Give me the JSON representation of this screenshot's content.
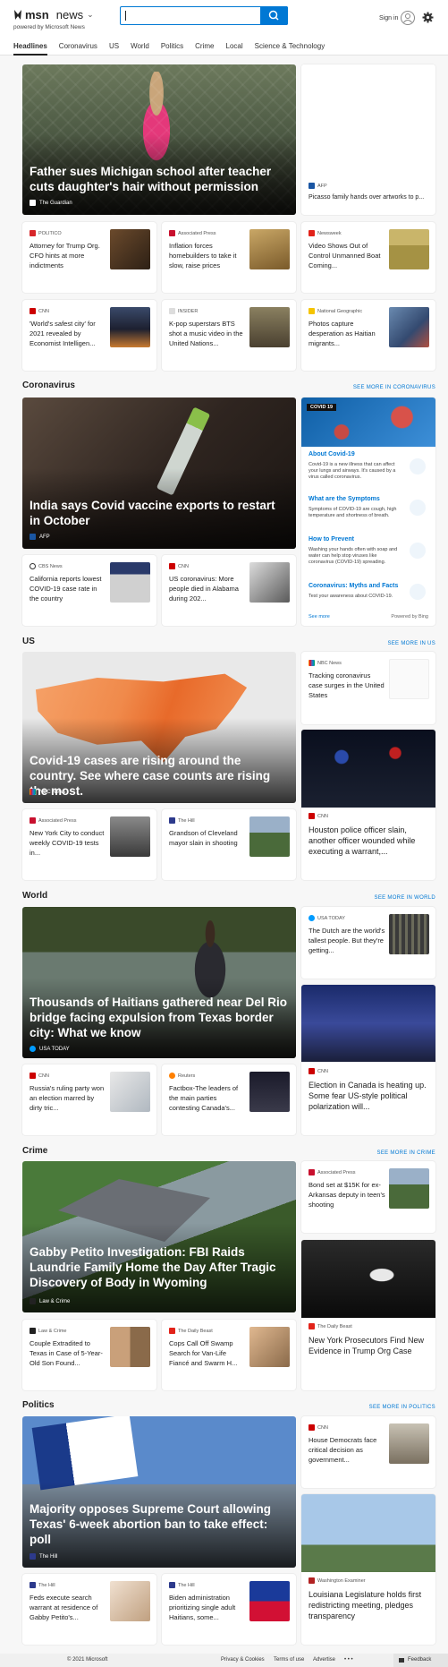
{
  "header": {
    "msn": "msn",
    "news": "news",
    "caret": "⌄",
    "powered": "powered by Microsoft News",
    "signin": "Sign in"
  },
  "nav": [
    "Headlines",
    "Coronavirus",
    "US",
    "World",
    "Politics",
    "Crime",
    "Local",
    "Science & Technology"
  ],
  "top": {
    "hero": {
      "title": "Father sues Michigan school after teacher cuts daughter's hair without permission",
      "source": "The Guardian"
    },
    "right": {
      "source": "AFP",
      "title": "Picasso family hands over artworks to p..."
    },
    "cards": [
      {
        "source": "POLITICO",
        "title": "Attorney for Trump Org. CFO hints at more indictments"
      },
      {
        "source": "Associated Press",
        "title": "Inflation forces homebuilders to take it slow, raise prices"
      },
      {
        "source": "Newsweek",
        "title": "Video Shows Out of Control Unmanned Boat Coming..."
      },
      {
        "source": "CNN",
        "title": "'World's safest city' for 2021 revealed by Economist Intelligen..."
      },
      {
        "source": "INSIDER",
        "title": "K-pop superstars BTS shot a music video in the United Nations..."
      },
      {
        "source": "National Geographic",
        "title": "Photos capture desperation as Haitian migrants..."
      }
    ]
  },
  "coronavirus": {
    "title": "Coronavirus",
    "see_more": "SEE MORE IN CORONAVIRUS",
    "hero": {
      "title": "India says Covid vaccine exports to restart in October",
      "source": "AFP"
    },
    "cards": [
      {
        "source": "CBS News",
        "title": "California reports lowest COVID-19 case rate in the country"
      },
      {
        "source": "CNN",
        "title": "US coronavirus: More people died in Alabama during 202..."
      }
    ],
    "panel": {
      "badge": "COVID 19",
      "items": [
        {
          "t": "About Covid-19",
          "d": "Covid-19 is a new illness that can affect your lungs and airways. It's caused by a virus called coronavirus."
        },
        {
          "t": "What are the Symptoms",
          "d": "Symptoms of COVID-19 are cough, high temperature and shortness of breath."
        },
        {
          "t": "How to Prevent",
          "d": "Washing your hands often with soap and water can help stop viruses like coronavirus (COVID-19) spreading."
        },
        {
          "t": "Coronavirus: Myths and Facts",
          "d": "Test your awareness about COVID-19."
        }
      ],
      "see_more": "See more",
      "powered": "Powered by Bing"
    }
  },
  "us": {
    "title": "US",
    "see_more": "SEE MORE IN US",
    "hero": {
      "title": "Covid-19 cases are rising around the country. See where case counts are rising the most.",
      "source": "NBC News"
    },
    "right": {
      "source": "NBC News",
      "title": "Tracking coronavirus case surges in the United States"
    },
    "cards": [
      {
        "source": "Associated Press",
        "title": "New York City to conduct weekly COVID-19 tests in..."
      },
      {
        "source": "The Hill",
        "title": "Grandson of Cleveland mayor slain in shooting"
      }
    ],
    "right2": {
      "source": "CNN",
      "title": "Houston police officer slain, another officer wounded while executing a warrant,..."
    }
  },
  "world": {
    "title": "World",
    "see_more": "SEE MORE IN WORLD",
    "hero": {
      "title": "Thousands of Haitians gathered near Del Rio bridge facing expulsion from Texas border city: What we know",
      "source": "USA TODAY"
    },
    "right": {
      "source": "USA TODAY",
      "title": "The Dutch are the world's tallest people. But they're getting..."
    },
    "cards": [
      {
        "source": "CNN",
        "title": "Russia's ruling party won an election marred by dirty tric..."
      },
      {
        "source": "Reuters",
        "title": "Factbox-The leaders of the main parties contesting Canada's..."
      }
    ],
    "right2": {
      "source": "CNN",
      "title": "Election in Canada is heating up. Some fear US-style political polarization will..."
    }
  },
  "crime": {
    "title": "Crime",
    "see_more": "SEE MORE IN CRIME",
    "hero": {
      "title": "Gabby Petito Investigation: FBI Raids Laundrie Family Home the Day After Tragic Discovery of Body in Wyoming",
      "source": "Law & Crime"
    },
    "right": {
      "source": "Associated Press",
      "title": "Bond set at $15K for ex-Arkansas deputy in teen's shooting"
    },
    "cards": [
      {
        "source": "Law & Crime",
        "title": "Couple Extradited to Texas in Case of 5-Year-Old Son Found..."
      },
      {
        "source": "The Daily Beast",
        "title": "Cops Call Off Swamp Search for Van-Life Fiancé and Swarm H..."
      }
    ],
    "right2": {
      "source": "The Daily Beast",
      "title": "New York Prosecutors Find New Evidence in Trump Org Case"
    }
  },
  "politics": {
    "title": "Politics",
    "see_more": "SEE MORE IN POLITICS",
    "hero": {
      "title": "Majority opposes Supreme Court allowing Texas' 6-week abortion ban to take effect: poll",
      "source": "The Hill"
    },
    "right": {
      "source": "CNN",
      "title": "House Democrats face critical decision as government..."
    },
    "cards": [
      {
        "source": "The Hill",
        "title": "Feds execute search warrant at residence of Gabby Petito's..."
      },
      {
        "source": "The Hill",
        "title": "Biden administration prioritizing single adult Haitians, some..."
      }
    ],
    "right2": {
      "source": "Washington Examiner",
      "title": "Louisiana Legislature holds first redistricting meeting, pledges transparency"
    }
  },
  "footer": {
    "copyright": "© 2021 Microsoft",
    "privacy": "Privacy & Cookies",
    "terms": "Terms of use",
    "advertise": "Advertise",
    "more": "• • •",
    "feedback": "Feedback"
  }
}
